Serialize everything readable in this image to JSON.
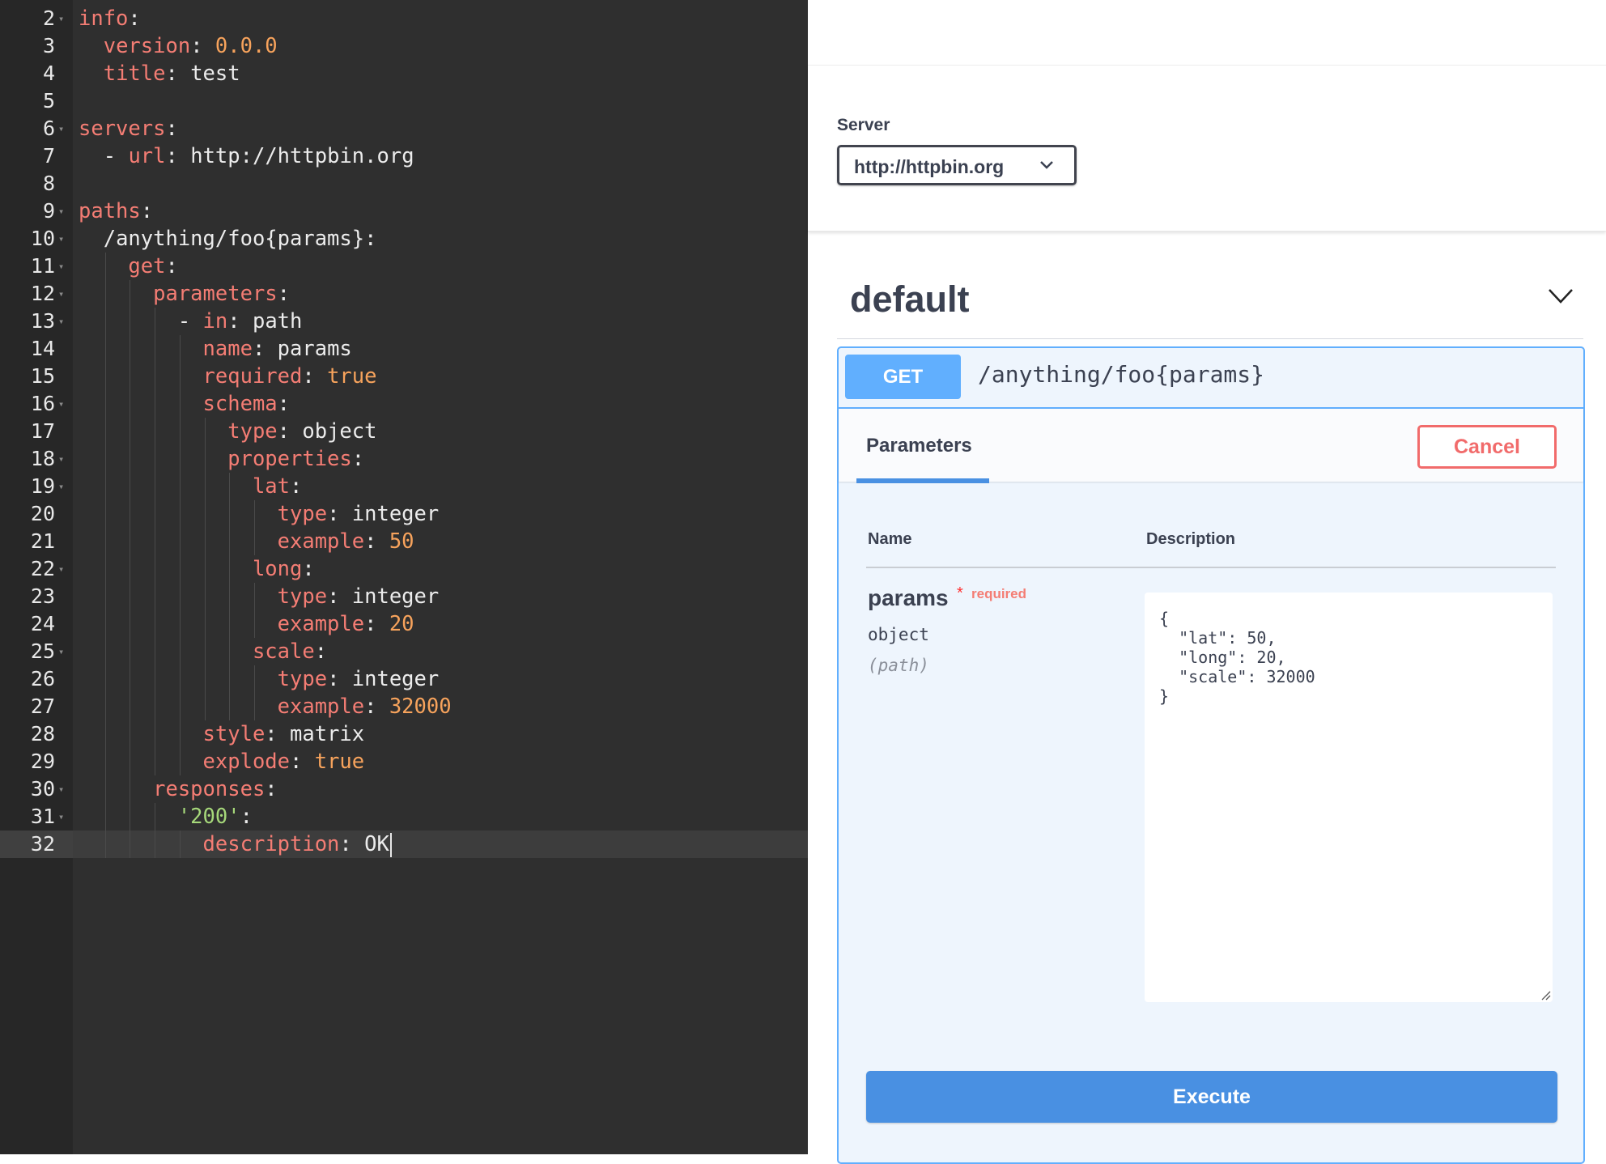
{
  "editor": {
    "lines": [
      {
        "num": "2",
        "text": "info:"
      },
      {
        "num": "3",
        "text": "  version: 0.0.0"
      },
      {
        "num": "4",
        "text": "  title: test"
      },
      {
        "num": "5",
        "text": ""
      },
      {
        "num": "6",
        "text": "servers:"
      },
      {
        "num": "7",
        "text": "  - url: http://httpbin.org"
      },
      {
        "num": "8",
        "text": ""
      },
      {
        "num": "9",
        "text": "paths:"
      },
      {
        "num": "10",
        "text": "  /anything/foo{params}:"
      },
      {
        "num": "11",
        "text": "    get:"
      },
      {
        "num": "12",
        "text": "      parameters:"
      },
      {
        "num": "13",
        "text": "        - in: path"
      },
      {
        "num": "14",
        "text": "          name: params"
      },
      {
        "num": "15",
        "text": "          required: true"
      },
      {
        "num": "16",
        "text": "          schema:"
      },
      {
        "num": "17",
        "text": "            type: object"
      },
      {
        "num": "18",
        "text": "            properties:"
      },
      {
        "num": "19",
        "text": "              lat:"
      },
      {
        "num": "20",
        "text": "                type: integer"
      },
      {
        "num": "21",
        "text": "                example: 50"
      },
      {
        "num": "22",
        "text": "              long:"
      },
      {
        "num": "23",
        "text": "                type: integer"
      },
      {
        "num": "24",
        "text": "                example: 20"
      },
      {
        "num": "25",
        "text": "              scale:"
      },
      {
        "num": "26",
        "text": "                type: integer"
      },
      {
        "num": "27",
        "text": "                example: 32000"
      },
      {
        "num": "28",
        "text": "          style: matrix"
      },
      {
        "num": "29",
        "text": "          explode: true"
      },
      {
        "num": "30",
        "text": "      responses:"
      },
      {
        "num": "31",
        "text": "        '200':"
      },
      {
        "num": "32",
        "text": "          description: OK"
      }
    ],
    "folded_lines": [
      "2",
      "6",
      "9",
      "10",
      "11",
      "12",
      "13",
      "16",
      "18",
      "19",
      "22",
      "25",
      "30",
      "31"
    ],
    "active_line": "32",
    "colors": {
      "background": "#2f2f2f",
      "key": "#f47d74",
      "number": "#f7a35c",
      "string": "#a6d87a",
      "text": "#ececec"
    }
  },
  "swagger": {
    "server": {
      "label": "Server",
      "selected": "http://httpbin.org",
      "icon": "chevron-down-icon"
    },
    "tag": {
      "title": "default",
      "icon": "chevron-down-icon"
    },
    "operation": {
      "method": "GET",
      "path": "/anything/foo{params}",
      "tab": "Parameters",
      "cancel_label": "Cancel",
      "columns": {
        "name": "Name",
        "description": "Description"
      },
      "parameter": {
        "name": "params",
        "required_star": "*",
        "required_label": "required",
        "type": "object",
        "in": "(path)",
        "value": "{\n  \"lat\": 50,\n  \"long\": 20,\n  \"scale\": 32000\n}"
      },
      "execute_label": "Execute"
    },
    "colors": {
      "get": "#61affe",
      "execute": "#4990e2",
      "cancel": "#f16b6b",
      "required": "#f47d74"
    }
  }
}
